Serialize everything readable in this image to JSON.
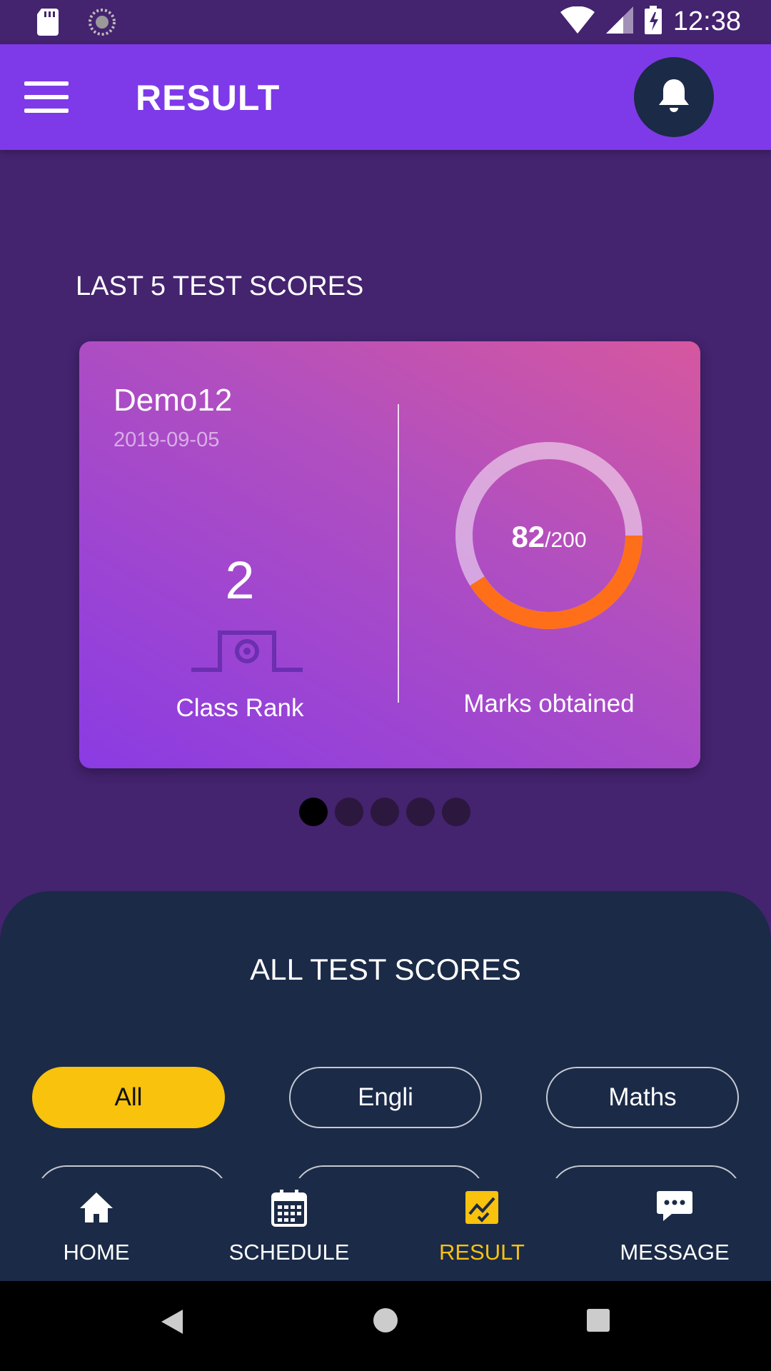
{
  "status_bar": {
    "time": "12:38"
  },
  "app_bar": {
    "title": "RESULT"
  },
  "last_scores": {
    "title": "LAST 5 TEST SCORES",
    "card": {
      "test_name": "Demo12",
      "date": "2019-09-05",
      "rank": "2",
      "rank_label": "Class Rank",
      "marks": "82",
      "total": "/200",
      "marks_fraction": 0.41,
      "marks_label": "Marks obtained"
    },
    "pager": {
      "count": 5,
      "active_index": 0
    }
  },
  "all_scores": {
    "title": "ALL TEST SCORES",
    "filters": [
      {
        "label": "All",
        "active": true
      },
      {
        "label": "Engli",
        "active": false
      },
      {
        "label": "Maths",
        "active": false
      }
    ]
  },
  "bottom_nav": {
    "items": [
      {
        "label": "HOME",
        "icon": "home-icon"
      },
      {
        "label": "SCHEDULE",
        "icon": "calendar-icon"
      },
      {
        "label": "RESULT",
        "icon": "result-chart-icon",
        "active": true
      },
      {
        "label": "MESSAGE",
        "icon": "message-icon"
      }
    ]
  },
  "colors": {
    "background": "#44236f",
    "app_bar": "#7e3ae8",
    "sheet": "#1b2a47",
    "accent_yellow": "#f8c20d",
    "donut_progress": "#ff6f1a"
  }
}
